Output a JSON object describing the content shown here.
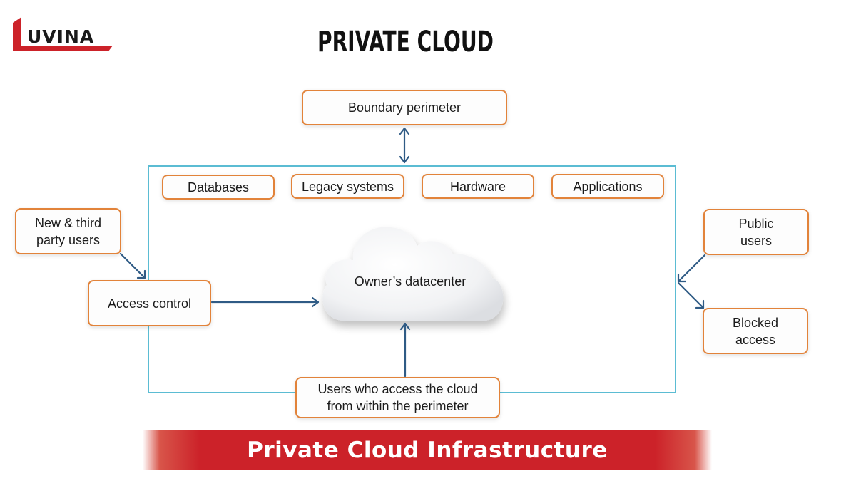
{
  "logo": {
    "text": "UVINA",
    "brand_color": "#cc2229"
  },
  "title": "PRIVATE CLOUD",
  "boundary": {
    "label": "Boundary perimeter"
  },
  "resources": [
    {
      "label": "Databases"
    },
    {
      "label": "Legacy systems"
    },
    {
      "label": "Hardware"
    },
    {
      "label": "Applications"
    }
  ],
  "left_nodes": {
    "third_party": "New & third party users",
    "access_control": "Access control"
  },
  "cloud": {
    "label": "Owner’s datacenter"
  },
  "right_nodes": {
    "public_users": "Public users",
    "blocked_access": "Blocked access"
  },
  "bottom_node": {
    "label": "Users who access the cloud from within the perimeter"
  },
  "banner": {
    "text": "Private Cloud Infrastructure",
    "color": "#cc2229"
  },
  "colors": {
    "box_border": "#e2833a",
    "perimeter_border": "#5bbcd3",
    "arrow": "#2f5b85"
  }
}
